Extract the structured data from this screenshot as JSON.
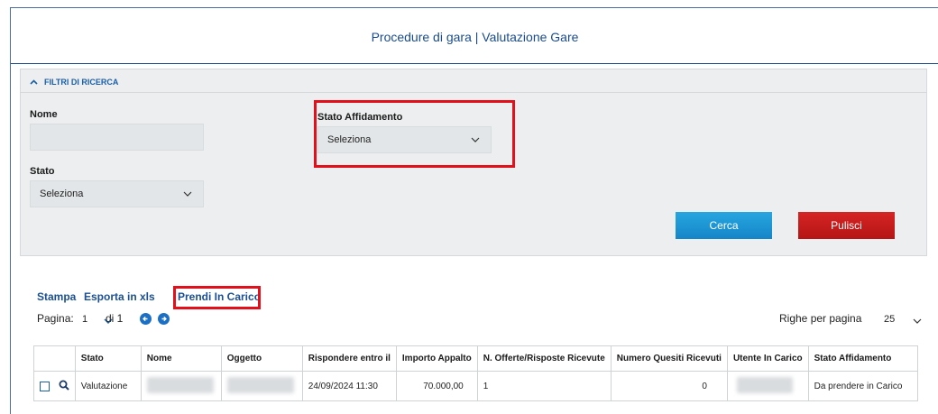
{
  "header": {
    "title": "Procedure di gara | Valutazione Gare"
  },
  "filters": {
    "section_label": "FILTRI DI RICERCA",
    "nome_label": "Nome",
    "nome_value": "",
    "stato_affidamento_label": "Stato Affidamento",
    "stato_affidamento_value": "Seleziona",
    "stato_label": "Stato",
    "stato_value": "Seleziona",
    "search_button": "Cerca",
    "clear_button": "Pulisci"
  },
  "actions": {
    "print": "Stampa",
    "export": "Esporta in xls",
    "take_charge": "Prendi In Carico"
  },
  "pagination": {
    "page_label": "Pagina:",
    "current_page": "1",
    "of_label": "di 1",
    "rows_label": "Righe per pagina",
    "rows_value": "25"
  },
  "table": {
    "headers": [
      "",
      "Stato",
      "Nome",
      "Oggetto",
      "Rispondere entro il",
      "Importo Appalto",
      "N. Offerte/Risposte Ricevute",
      "Numero Quesiti Ricevuti",
      "Utente In Carico",
      "Stato Affidamento"
    ],
    "rows": [
      {
        "stato": "Valutazione",
        "nome": "",
        "oggetto": "",
        "rispondere": "24/09/2024 11:30",
        "importo": "70.000,00",
        "offerte": "1",
        "quesiti": "0",
        "utente": "",
        "stato_affidamento": "Da prendere in Carico"
      }
    ]
  },
  "colors": {
    "primary": "#1b5fa8",
    "highlight": "#e3101c",
    "search": "#1f97d8",
    "clear": "#c41c1c"
  },
  "icons": [
    "chevron-up-icon",
    "chevron-down-icon",
    "arrow-left-circle-icon",
    "arrow-right-circle-icon",
    "search-icon"
  ]
}
